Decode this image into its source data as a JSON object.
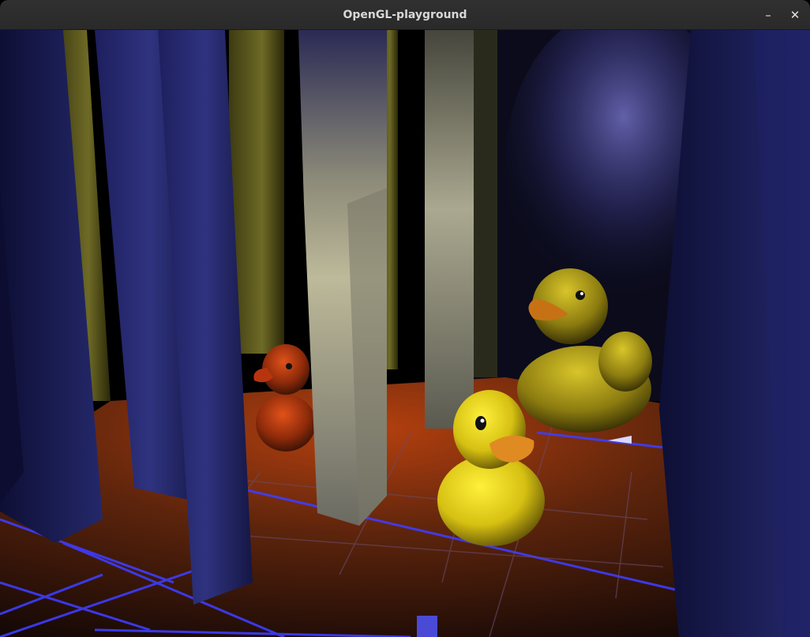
{
  "window": {
    "title": "OpenGL-playground",
    "minimize_glyph": "–",
    "close_glyph": "✕"
  },
  "scene": {
    "description_objects": [
      "rubber-duck",
      "rubber-duck",
      "rubber-duck",
      "pillar",
      "tiled-floor",
      "spotlight"
    ],
    "colors": {
      "titlebar": "#2d2d2d",
      "floor_tile": "#8a3a0c",
      "grid_line": "#3a3aff",
      "duck_yellow": "#e6d21a",
      "duck_red": "#c0390e",
      "duck_beak": "#e8891c",
      "pillar_blue": "#2c2f7a",
      "pillar_lit": "#b9b592",
      "background": "#000000"
    }
  }
}
